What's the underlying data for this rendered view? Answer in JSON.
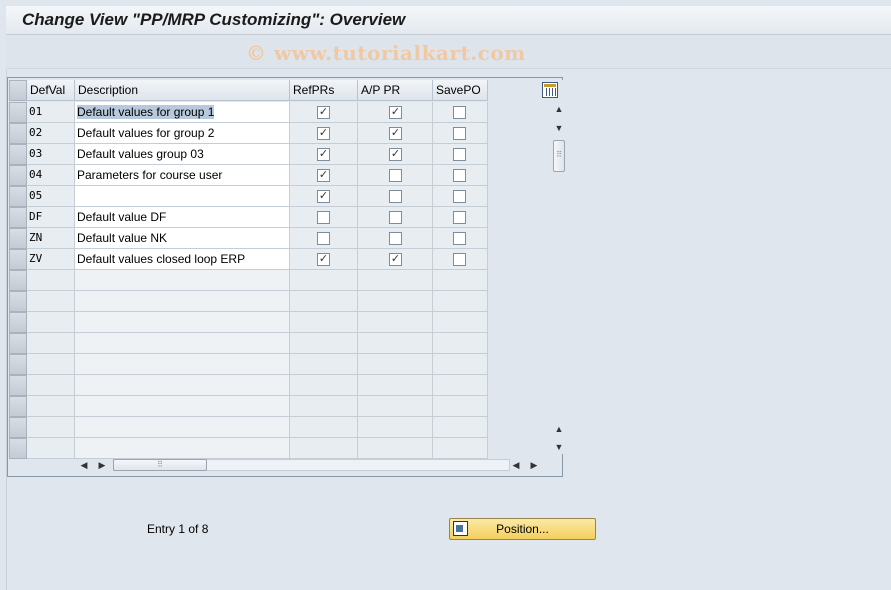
{
  "window": {
    "title": "Change View \"PP/MRP Customizing\": Overview"
  },
  "watermark": "© www.tutorialkart.com",
  "table": {
    "columns": [
      "DefVal",
      "Description",
      "RefPRs",
      "A/P PR",
      "SavePO"
    ],
    "rows": [
      {
        "defval": "01",
        "description": "Default values for group 1",
        "refprs": true,
        "appr": true,
        "savepo": false
      },
      {
        "defval": "02",
        "description": "Default values for group 2",
        "refprs": true,
        "appr": true,
        "savepo": false
      },
      {
        "defval": "03",
        "description": "Default values group 03",
        "refprs": true,
        "appr": true,
        "savepo": false
      },
      {
        "defval": "04",
        "description": "Parameters for course user",
        "refprs": true,
        "appr": false,
        "savepo": false
      },
      {
        "defval": "05",
        "description": "",
        "refprs": true,
        "appr": false,
        "savepo": false
      },
      {
        "defval": "DF",
        "description": "Default value DF",
        "refprs": false,
        "appr": false,
        "savepo": false
      },
      {
        "defval": "ZN",
        "description": "Default value NK",
        "refprs": false,
        "appr": false,
        "savepo": false
      },
      {
        "defval": "ZV",
        "description": "Default values closed loop ERP",
        "refprs": true,
        "appr": true,
        "savepo": false
      }
    ],
    "empty_rows": 9
  },
  "footer": {
    "entry_text": "Entry 1 of 8",
    "position_button": "Position..."
  },
  "icons": {
    "config": "table-settings-icon",
    "position": "position-icon",
    "scroll_up": "arrow-up-icon",
    "scroll_down": "arrow-down-icon",
    "scroll_left": "arrow-left-icon",
    "scroll_right": "arrow-right-icon"
  }
}
